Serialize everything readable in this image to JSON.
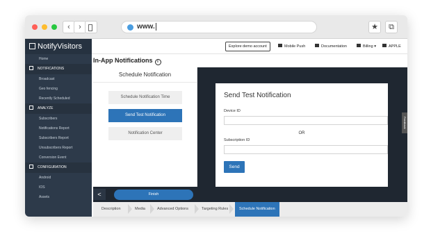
{
  "browser": {
    "url": "www.",
    "colors": {
      "red": "#ff5f57",
      "yellow": "#febc2e",
      "green": "#28c840"
    }
  },
  "app": {
    "name": "NotifyVisitors"
  },
  "sidebar": {
    "items": [
      {
        "type": "item",
        "label": "Home"
      },
      {
        "type": "section",
        "label": "NOTIFICATIONS"
      },
      {
        "type": "item",
        "label": "Broadcast"
      },
      {
        "type": "item",
        "label": "Geo fencing"
      },
      {
        "type": "item",
        "label": "Recently Scheduled"
      },
      {
        "type": "section",
        "label": "ANALYZE"
      },
      {
        "type": "item",
        "label": "Subscribers"
      },
      {
        "type": "item",
        "label": "Notifications Report"
      },
      {
        "type": "item",
        "label": "Subscribers Report"
      },
      {
        "type": "item",
        "label": "Unsubscribers Report"
      },
      {
        "type": "item",
        "label": "Conversion Event"
      },
      {
        "type": "section",
        "label": "CONFIGURATION"
      },
      {
        "type": "item",
        "label": "Android"
      },
      {
        "type": "item",
        "label": "IOS"
      },
      {
        "type": "item",
        "label": "Assets"
      }
    ]
  },
  "topbar": {
    "explore": "Explore demo account",
    "mobile_push": "Mobile Push",
    "documentation": "Documentation",
    "billing": "Billing",
    "account": "APPLE"
  },
  "page": {
    "title": "In-App Notifications",
    "left_panel": {
      "heading": "Schedule Notification",
      "options": [
        "Schedule Notification Time",
        "Send Test Notification",
        "Notification Center"
      ]
    },
    "dialog": {
      "title": "Send Test Notification",
      "device_label": "Device ID",
      "or": "OR",
      "subscription_label": "Subscription ID",
      "send": "Send"
    },
    "feedback": "Feedback",
    "finish": "Finish",
    "back": "<",
    "steps": [
      "Description",
      "Media",
      "Advanced Options",
      "Targeting Rules",
      "Schedule Notification"
    ]
  }
}
